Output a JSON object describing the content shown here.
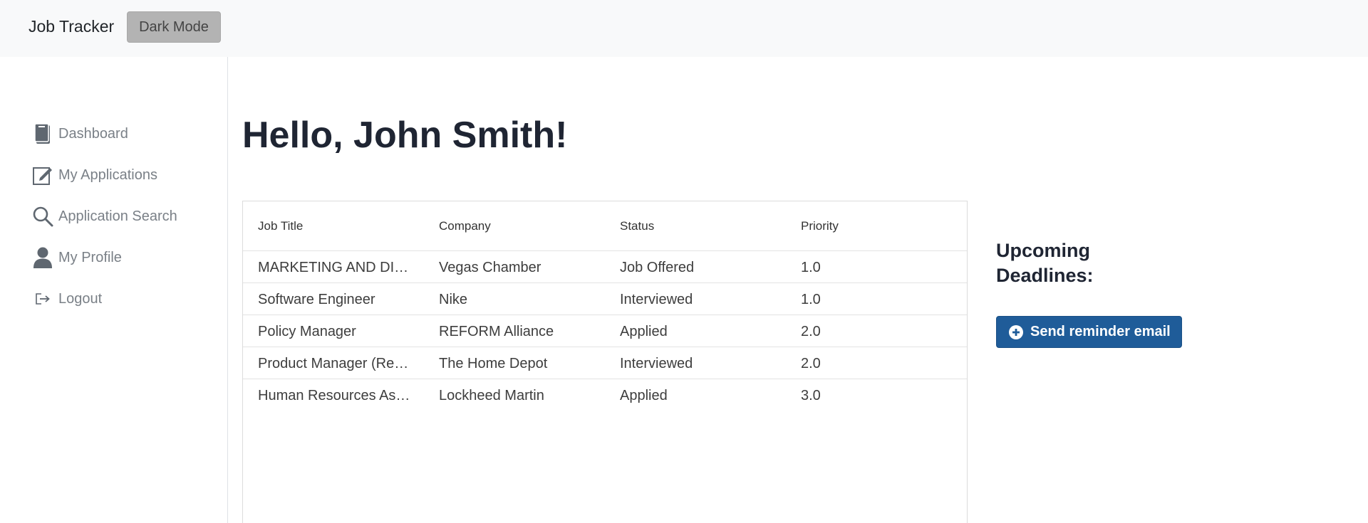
{
  "navbar": {
    "brand": "Job Tracker",
    "dark_mode_label": "Dark Mode"
  },
  "sidebar": {
    "items": [
      {
        "label": "Dashboard",
        "icon": "journal-icon"
      },
      {
        "label": "My Applications",
        "icon": "pencil-square-icon"
      },
      {
        "label": "Application Search",
        "icon": "search-icon"
      },
      {
        "label": "My Profile",
        "icon": "person-icon"
      },
      {
        "label": "Logout",
        "icon": "box-arrow-right-icon"
      }
    ]
  },
  "main": {
    "greeting": "Hello, John Smith!",
    "table": {
      "headers": [
        "Job Title",
        "Company",
        "Status",
        "Priority"
      ],
      "rows": [
        {
          "title": "MARKETING AND DIGITAL",
          "company": "Vegas Chamber",
          "status": "Job Offered",
          "priority": "1.0"
        },
        {
          "title": "Software Engineer",
          "company": "Nike",
          "status": "Interviewed",
          "priority": "1.0"
        },
        {
          "title": "Policy Manager",
          "company": "REFORM Alliance",
          "status": "Applied",
          "priority": "2.0"
        },
        {
          "title": "Product Manager (Remote)",
          "company": "The Home Depot",
          "status": "Interviewed",
          "priority": "2.0"
        },
        {
          "title": "Human Resources Assistant",
          "company": "Lockheed Martin",
          "status": "Applied",
          "priority": "3.0"
        }
      ]
    },
    "deadlines_title": "Upcoming Deadlines:",
    "reminder_button": "Send reminder email"
  },
  "colors": {
    "navbar_bg": "#f8f9fa",
    "primary_button": "#1f5c99",
    "dark_mode_button": "#b3b3b3",
    "sidebar_text": "#7a8087",
    "icon": "#5f6770"
  }
}
